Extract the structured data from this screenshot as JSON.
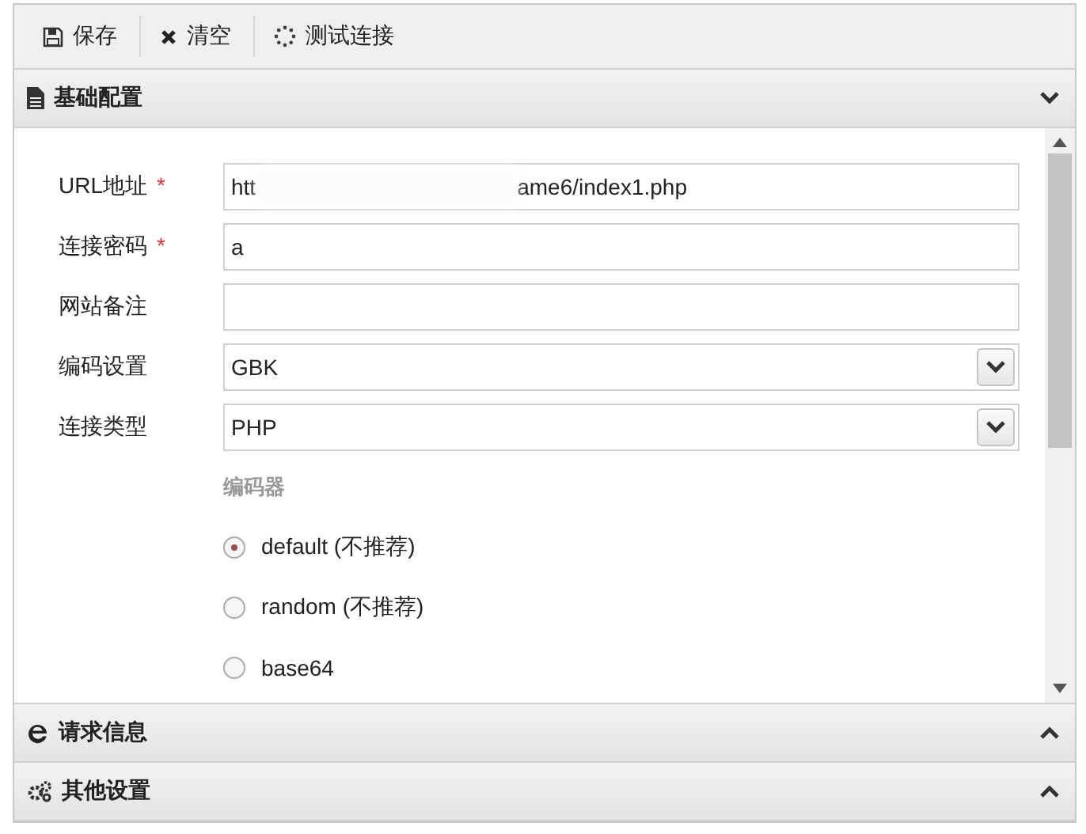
{
  "toolbar": [
    {
      "label": "保存"
    },
    {
      "label": "清空"
    },
    {
      "label": "测试连接"
    }
  ],
  "sections": [
    {
      "title": "基础配置",
      "expanded": true,
      "fields": [
        {
          "kind": "text",
          "label": "URL地址",
          "required_mark": "*",
          "value_start": "htt",
          "value_end": "ame6/index1.php"
        },
        {
          "kind": "text",
          "label": "连接密码",
          "required_mark": "*",
          "value_start": "a"
        },
        {
          "kind": "text",
          "label": "网站备注"
        },
        {
          "kind": "select",
          "label": "编码设置",
          "value_start": "GBK"
        },
        {
          "kind": "select",
          "label": "连接类型",
          "value_start": "PHP"
        }
      ],
      "encoder": {
        "title": "编码器",
        "options": [
          {
            "label": "default (不推荐)",
            "selected": true
          },
          {
            "label": "random (不推荐)",
            "selected": false
          },
          {
            "label": "base64",
            "selected": false
          }
        ]
      }
    },
    {
      "title": "请求信息",
      "expanded": false
    },
    {
      "title": "其他设置",
      "expanded": false
    }
  ]
}
